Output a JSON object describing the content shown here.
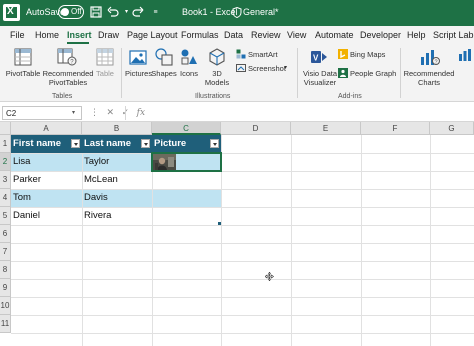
{
  "titlebar": {
    "autosave_label": "AutoSave",
    "autosave_state": "Off",
    "title": "Book1  -  Excel",
    "sensitivity": "General*"
  },
  "menu": {
    "items": [
      "File",
      "Home",
      "Insert",
      "Draw",
      "Page Layout",
      "Formulas",
      "Data",
      "Review",
      "View",
      "Automate",
      "Developer",
      "Help",
      "Script Lab"
    ],
    "active": "Insert"
  },
  "ribbon": {
    "tables": {
      "pivottable": "PivotTable",
      "recommended_pivottables": "Recommended PivotTables",
      "table": "Table",
      "group_label": "Tables"
    },
    "illustrations": {
      "pictures": "Pictures",
      "shapes": "Shapes",
      "icons": "Icons",
      "models3d": "3D Models",
      "smartart": "SmartArt",
      "screenshot": "Screenshot",
      "group_label": "Illustrations"
    },
    "addins": {
      "visio": "Visio Data Visualizer",
      "bing_maps": "Bing Maps",
      "people_graph": "People Graph",
      "group_label": "Add-ins"
    },
    "charts": {
      "recommended_charts": "Recommended Charts"
    }
  },
  "formulabar": {
    "name_box": "C2",
    "fx": "fx"
  },
  "grid": {
    "columns": [
      "A",
      "B",
      "C",
      "D",
      "E",
      "F",
      "G"
    ],
    "selected_column": "C",
    "rows": [
      "1",
      "2",
      "3",
      "4",
      "5",
      "6",
      "7",
      "8",
      "9",
      "10",
      "11"
    ],
    "selected_row": "2",
    "table_headers": [
      "First name",
      "Last name",
      "Picture"
    ],
    "table_rows": [
      {
        "first": "Lisa",
        "last": "Taylor"
      },
      {
        "first": "Parker",
        "last": "McLean"
      },
      {
        "first": "Tom",
        "last": "Davis"
      },
      {
        "first": "Daniel",
        "last": "Rivera"
      }
    ]
  },
  "colors": {
    "excel_green": "#1e7145",
    "table_header": "#1f5f7a",
    "band": "#bfe3f2"
  }
}
